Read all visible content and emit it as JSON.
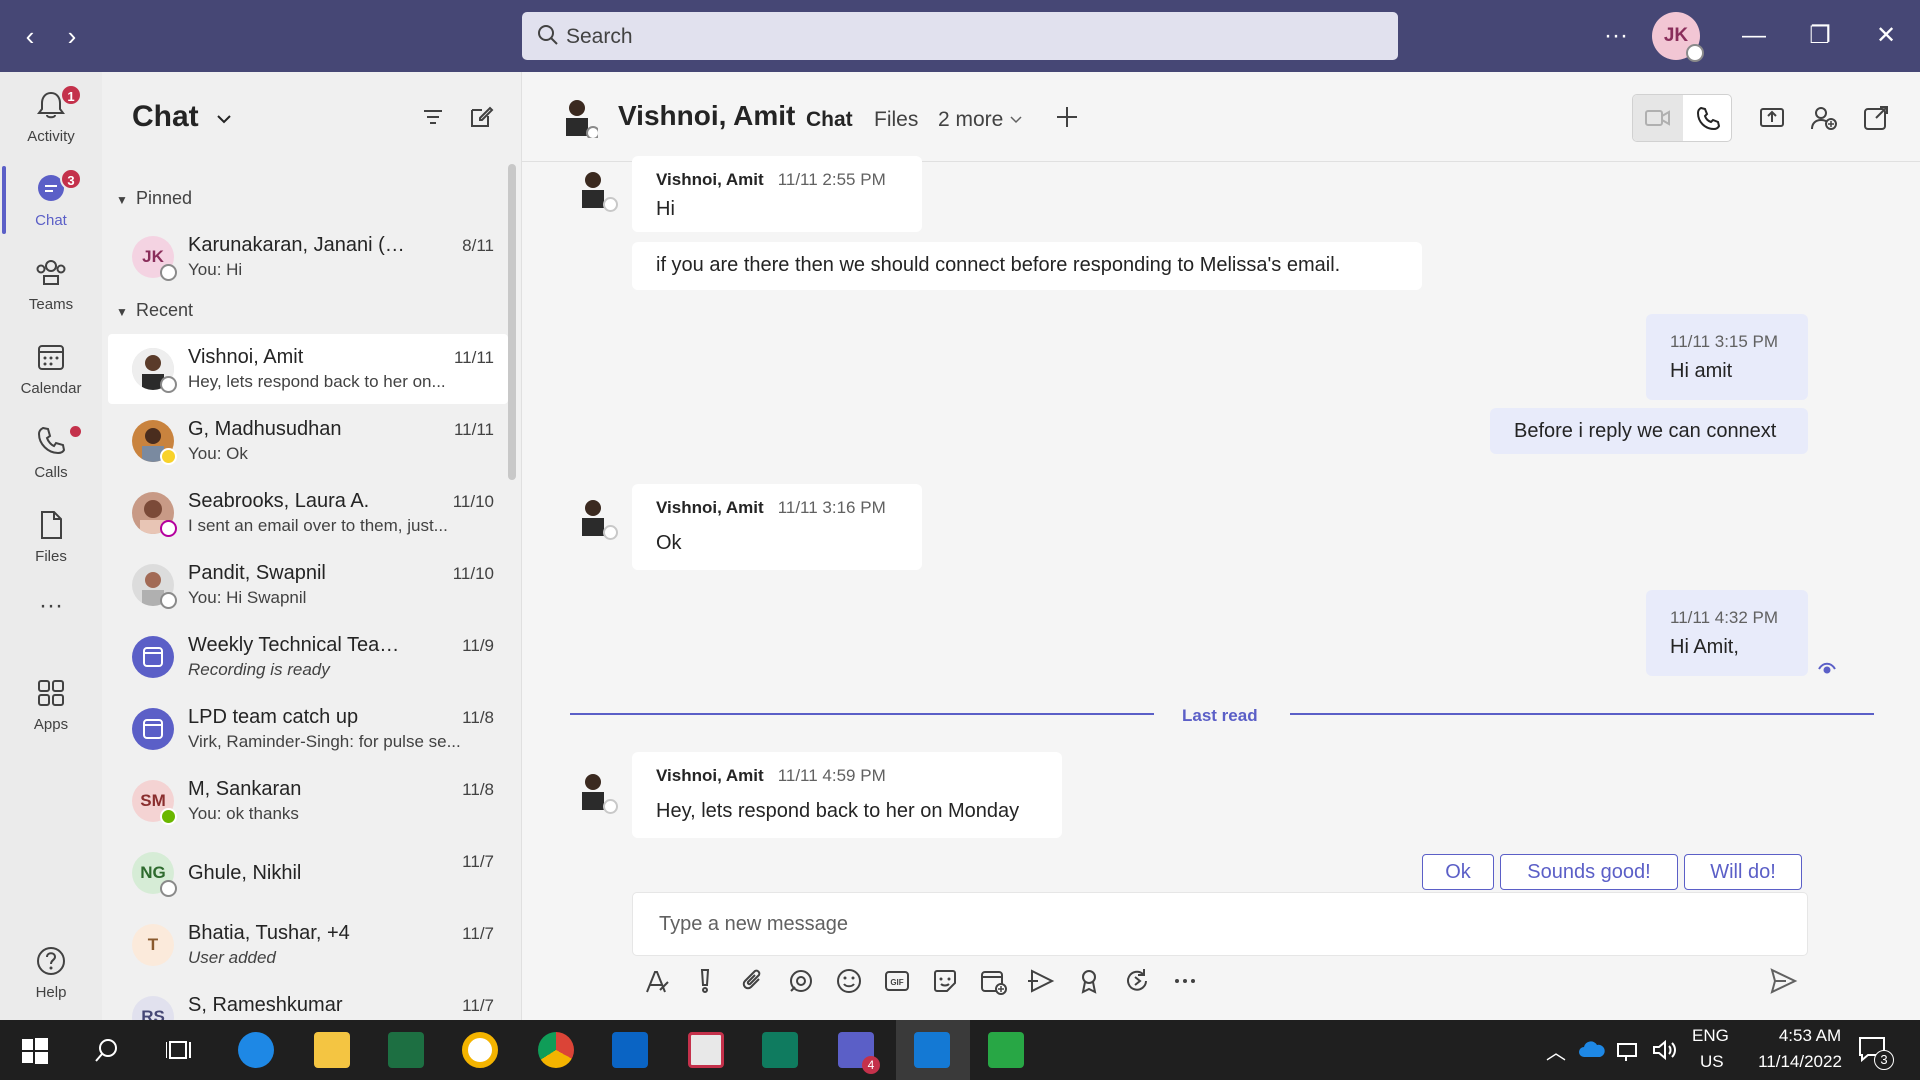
{
  "titlebar": {
    "search_placeholder": "Search",
    "more_label": "···",
    "me_initials": "JK",
    "minimize_label": "—",
    "restore_label": "❐",
    "close_label": "✕",
    "back_label": "‹",
    "forward_label": "›"
  },
  "rail": {
    "items": [
      {
        "label": "Activity",
        "badge": "1"
      },
      {
        "label": "Chat",
        "badge": "3"
      },
      {
        "label": "Teams"
      },
      {
        "label": "Calendar"
      },
      {
        "label": "Calls"
      },
      {
        "label": "Files"
      },
      {
        "label": "···"
      },
      {
        "label": "Apps"
      },
      {
        "label": "Help"
      }
    ]
  },
  "chat_list": {
    "title": "Chat",
    "pinned_label": "Pinned",
    "recent_label": "Recent",
    "pinned": [
      {
        "initials": "JK",
        "name": "Karunakaran, Janani (You)",
        "preview": "You: Hi",
        "date": "8/11"
      }
    ],
    "recent": [
      {
        "name": "Vishnoi, Amit",
        "preview": "Hey, lets respond back to her on...",
        "date": "11/11"
      },
      {
        "name": "G, Madhusudhan",
        "preview": "You: Ok",
        "date": "11/11"
      },
      {
        "name": "Seabrooks, Laura A.",
        "preview": "I sent an email over to them, just...",
        "date": "11/10"
      },
      {
        "name": "Pandit, Swapnil",
        "preview": "You: Hi Swapnil",
        "date": "11/10"
      },
      {
        "name": "Weekly Technical Team M...",
        "preview": "Recording is ready",
        "date": "11/9"
      },
      {
        "name": "LPD team catch up",
        "preview": "Virk, Raminder-Singh: for pulse se...",
        "date": "11/8"
      },
      {
        "initials": "SM",
        "name": "M, Sankaran",
        "preview": "You: ok thanks",
        "date": "11/8"
      },
      {
        "initials": "NG",
        "name": "Ghule, Nikhil",
        "preview": "",
        "date": "11/7"
      },
      {
        "initials": "T",
        "name": "Bhatia, Tushar, +4",
        "preview": "User added",
        "date": "11/7"
      },
      {
        "initials": "RS",
        "name": "S, Rameshkumar",
        "preview": "",
        "date": "11/7"
      }
    ]
  },
  "conversation": {
    "name": "Vishnoi, Amit",
    "tabs": [
      "Chat",
      "Files",
      "2 more"
    ],
    "last_read_label": "Last read",
    "messages": [
      {
        "sender": "Vishnoi, Amit",
        "time": "11/11 2:55 PM",
        "text": "Hi"
      },
      {
        "text": "if you are there then we should connect before responding to Melissa's email."
      },
      {
        "time": "11/11 3:15 PM",
        "text": "Hi amit"
      },
      {
        "text": "Before i reply we can connext"
      },
      {
        "sender": "Vishnoi, Amit",
        "time": "11/11 3:16 PM",
        "text": "Ok"
      },
      {
        "time": "11/11 4:32 PM",
        "text": "Hi Amit,"
      },
      {
        "sender": "Vishnoi, Amit",
        "time": "11/11 4:59 PM",
        "text": "Hey, lets respond back to her on Monday"
      }
    ],
    "quick_replies": [
      "Ok",
      "Sounds good!",
      "Will do!"
    ],
    "compose_placeholder": "Type a new message"
  },
  "taskbar": {
    "lang": "ENG",
    "region": "US",
    "time": "4:53 AM",
    "date": "11/14/2022",
    "notification_count": "3",
    "teams_badge": "4"
  },
  "colors": {
    "brand": "#464775",
    "accent": "#5b5fc7",
    "badge": "#c4314b"
  }
}
